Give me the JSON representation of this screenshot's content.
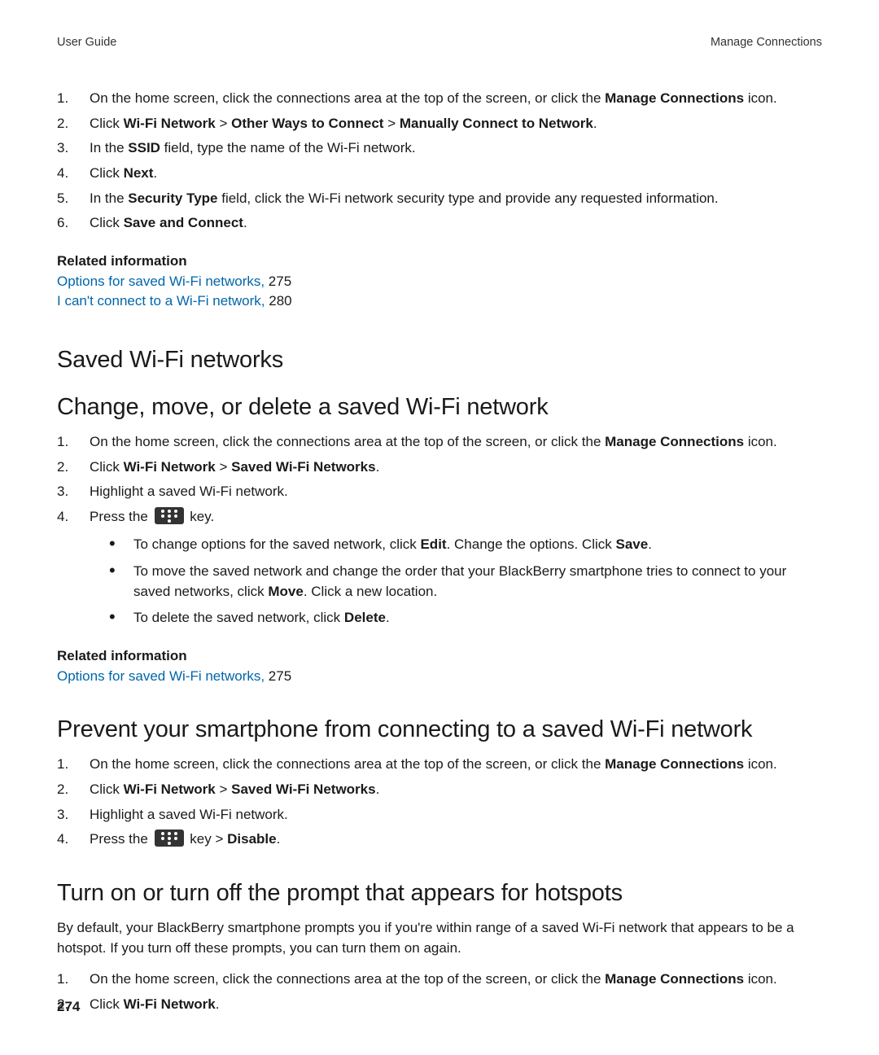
{
  "header": {
    "left": "User Guide",
    "right": "Manage Connections"
  },
  "page_number": "274",
  "top_steps": [
    {
      "pre": "On the home screen, click the connections area at the top of the screen, or click the ",
      "b1": "Manage Connections",
      "post1": " icon."
    },
    {
      "pre": "Click ",
      "b1": "Wi-Fi Network",
      "mid1": " > ",
      "b2": "Other Ways to Connect",
      "mid2": " > ",
      "b3": "Manually Connect to Network",
      "post1": "."
    },
    {
      "pre": "In the ",
      "b1": "SSID",
      "post1": " field, type the name of the Wi-Fi network."
    },
    {
      "pre": "Click ",
      "b1": "Next",
      "post1": "."
    },
    {
      "pre": "In the ",
      "b1": "Security Type",
      "post1": " field, click the Wi-Fi network security type and provide any requested information."
    },
    {
      "pre": "Click ",
      "b1": "Save and Connect",
      "post1": "."
    }
  ],
  "related1": {
    "head": "Related information",
    "links": [
      {
        "text": "Options for saved Wi-Fi networks,",
        "page": " 275"
      },
      {
        "text": "I can't connect to a Wi-Fi network,",
        "page": " 280"
      }
    ]
  },
  "h_saved": "Saved Wi-Fi networks",
  "h_change": "Change, move, or delete a saved Wi-Fi network",
  "change_steps": [
    {
      "pre": "On the home screen, click the connections area at the top of the screen, or click the ",
      "b1": "Manage Connections",
      "post1": " icon."
    },
    {
      "pre": "Click ",
      "b1": "Wi-Fi Network",
      "mid1": " > ",
      "b2": "Saved Wi-Fi Networks",
      "post1": "."
    },
    {
      "pre": "Highlight a saved Wi-Fi network."
    },
    {
      "pre": "Press the ",
      "icon": true,
      "post1": " key."
    }
  ],
  "change_sub": [
    {
      "pre": "To change options for the saved network, click ",
      "b1": "Edit",
      "mid1": ". Change the options. Click ",
      "b2": "Save",
      "post1": "."
    },
    {
      "pre": "To move the saved network and change the order that your BlackBerry smartphone tries to connect to your saved networks, click ",
      "b1": "Move",
      "post1": ". Click a new location."
    },
    {
      "pre": "To delete the saved network, click ",
      "b1": "Delete",
      "post1": "."
    }
  ],
  "related2": {
    "head": "Related information",
    "links": [
      {
        "text": "Options for saved Wi-Fi networks,",
        "page": " 275"
      }
    ]
  },
  "h_prevent": "Prevent your smartphone from connecting to a saved Wi-Fi network",
  "prevent_steps": [
    {
      "pre": "On the home screen, click the connections area at the top of the screen, or click the ",
      "b1": "Manage Connections",
      "post1": " icon."
    },
    {
      "pre": "Click ",
      "b1": "Wi-Fi Network",
      "mid1": " > ",
      "b2": "Saved Wi-Fi Networks",
      "post1": "."
    },
    {
      "pre": "Highlight a saved Wi-Fi network."
    },
    {
      "pre": "Press the ",
      "icon": true,
      "mid1": " key > ",
      "b1": "Disable",
      "post1": "."
    }
  ],
  "h_hotspot": "Turn on or turn off the prompt that appears for hotspots",
  "hotspot_para": "By default, your BlackBerry smartphone prompts you if you're within range of a saved Wi-Fi network that appears to be a hotspot. If you turn off these prompts, you can turn them on again.",
  "hotspot_steps": [
    {
      "pre": "On the home screen, click the connections area at the top of the screen, or click the ",
      "b1": "Manage Connections",
      "post1": " icon."
    },
    {
      "pre": "Click ",
      "b1": "Wi-Fi Network",
      "post1": "."
    }
  ]
}
